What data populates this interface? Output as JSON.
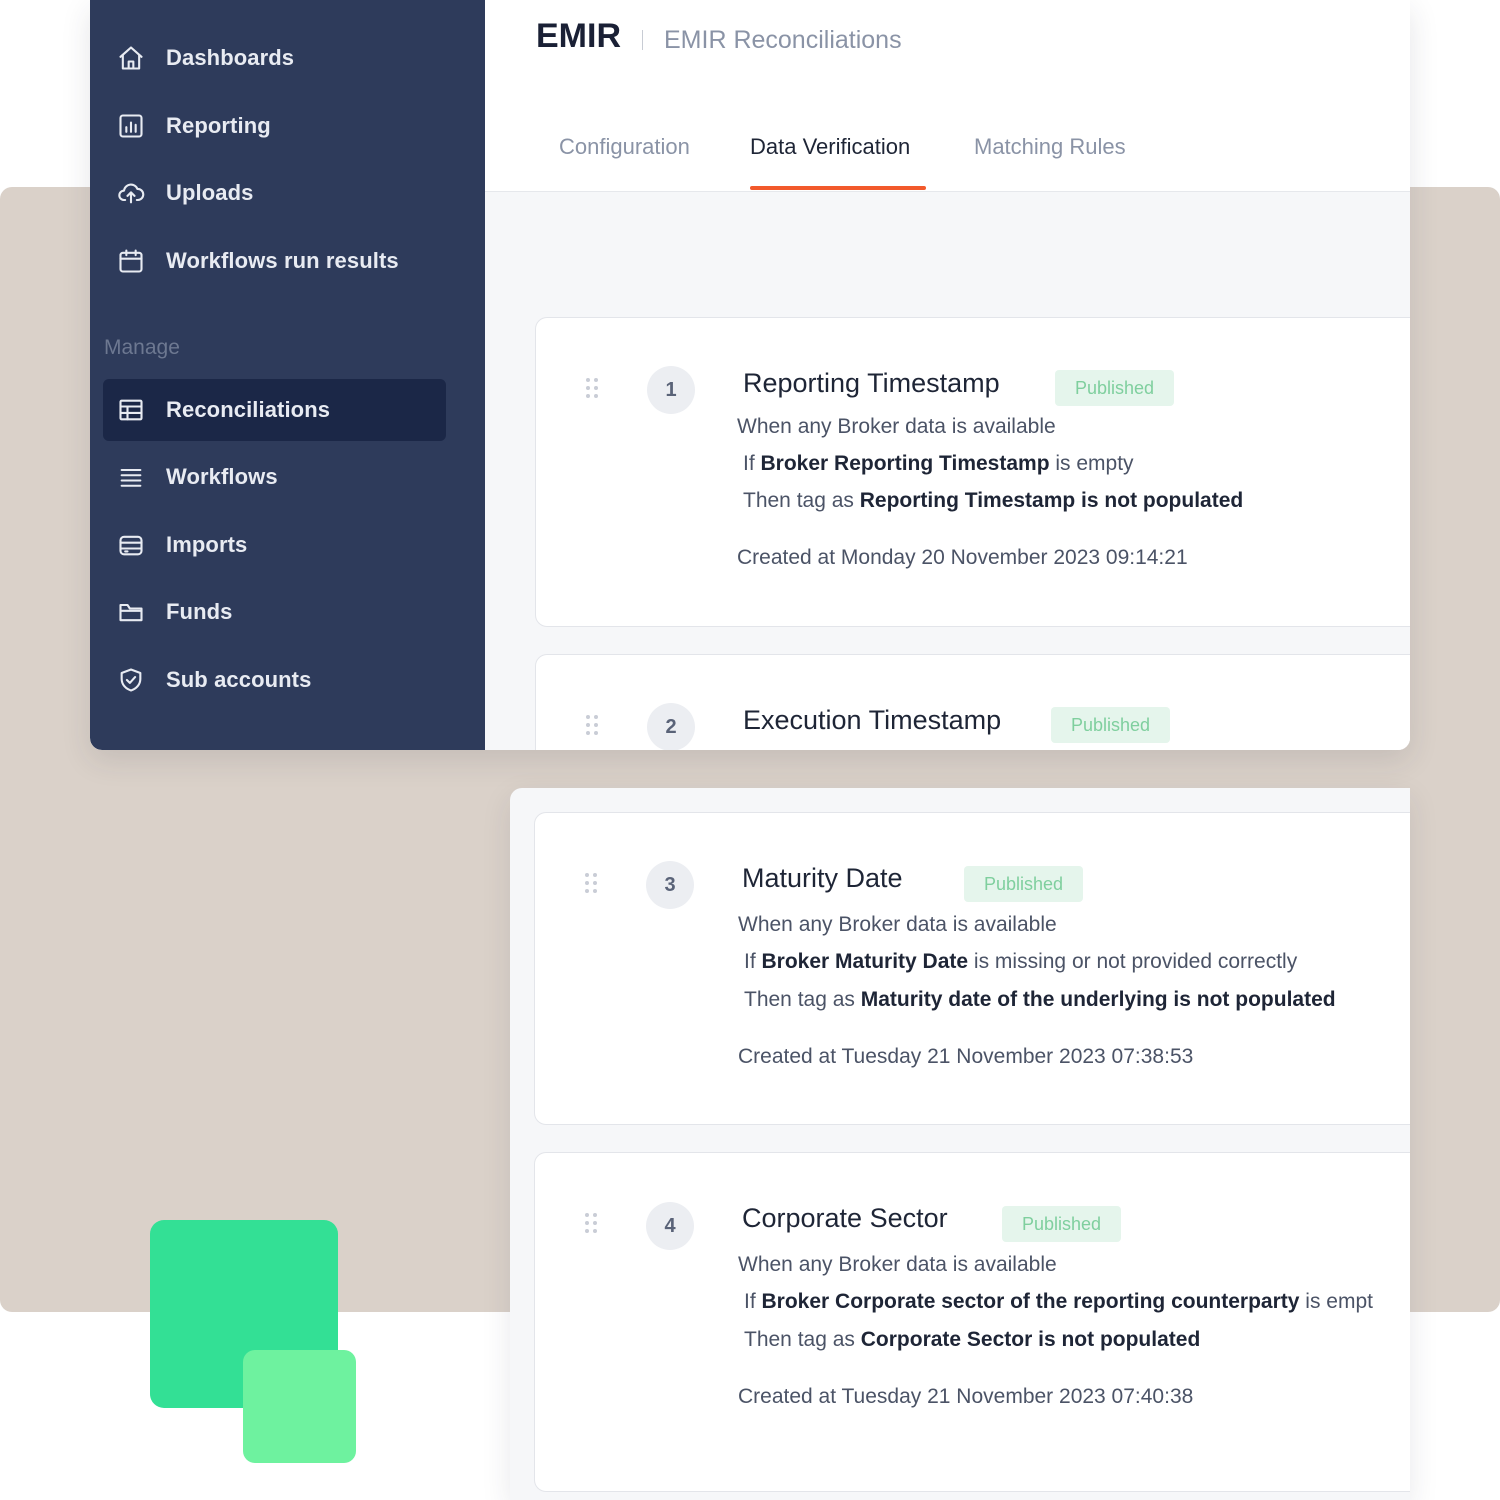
{
  "sidebar": {
    "items": [
      {
        "label": "Dashboards",
        "icon": "home-icon"
      },
      {
        "label": "Reporting",
        "icon": "chart-icon"
      },
      {
        "label": "Uploads",
        "icon": "cloud-upload-icon"
      },
      {
        "label": "Workflows run results",
        "icon": "calendar-icon"
      }
    ],
    "section_label": "Manage",
    "manage_items": [
      {
        "label": "Reconciliations",
        "icon": "table-icon",
        "active": true
      },
      {
        "label": "Workflows",
        "icon": "list-icon"
      },
      {
        "label": "Imports",
        "icon": "database-icon"
      },
      {
        "label": "Funds",
        "icon": "folder-icon"
      },
      {
        "label": "Sub accounts",
        "icon": "shield-check-icon"
      }
    ]
  },
  "header": {
    "title": "EMIR",
    "subtitle": "EMIR Reconciliations",
    "tabs": [
      {
        "label": "Configuration"
      },
      {
        "label": "Data Verification",
        "active": true
      },
      {
        "label": "Matching Rules"
      }
    ]
  },
  "rules": [
    {
      "number": "1",
      "title": "Reporting Timestamp",
      "status": "Published",
      "condition": "When any Broker data is available",
      "if_prefix": "If",
      "if_field": "Broker Reporting Timestamp",
      "if_suffix": "is empty",
      "then_prefix": "Then tag as",
      "then_tag": "Reporting Timestamp is not populated",
      "created": "Created at Monday 20 November 2023 09:14:21"
    },
    {
      "number": "2",
      "title": "Execution Timestamp",
      "status": "Published"
    },
    {
      "number": "3",
      "title": "Maturity Date",
      "status": "Published",
      "condition": "When any Broker data is available",
      "if_prefix": "If",
      "if_field": "Broker Maturity Date",
      "if_suffix": "is missing or not provided correctly",
      "then_prefix": "Then tag as",
      "then_tag": "Maturity date of the underlying is not populated",
      "created": "Created at Tuesday 21 November 2023 07:38:53"
    },
    {
      "number": "4",
      "title": "Corporate Sector",
      "status": "Published",
      "condition": "When any Broker data is available",
      "if_prefix": "If",
      "if_field": "Broker Corporate sector of the reporting counterparty",
      "if_suffix": "is empt",
      "then_prefix": "Then tag as",
      "then_tag": "Corporate Sector is not populated",
      "created": "Created at Tuesday 21 November 2023 07:40:38"
    }
  ],
  "colors": {
    "sidebar_bg": "#2e3b5b",
    "sidebar_active": "#1b2747",
    "tab_accent": "#f2592b",
    "badge_bg": "#e5f5ec",
    "badge_text": "#7fcf9e",
    "backdrop": "#dad1c9",
    "deco_green": "#33e095",
    "deco_green_light": "#6ef29f"
  }
}
